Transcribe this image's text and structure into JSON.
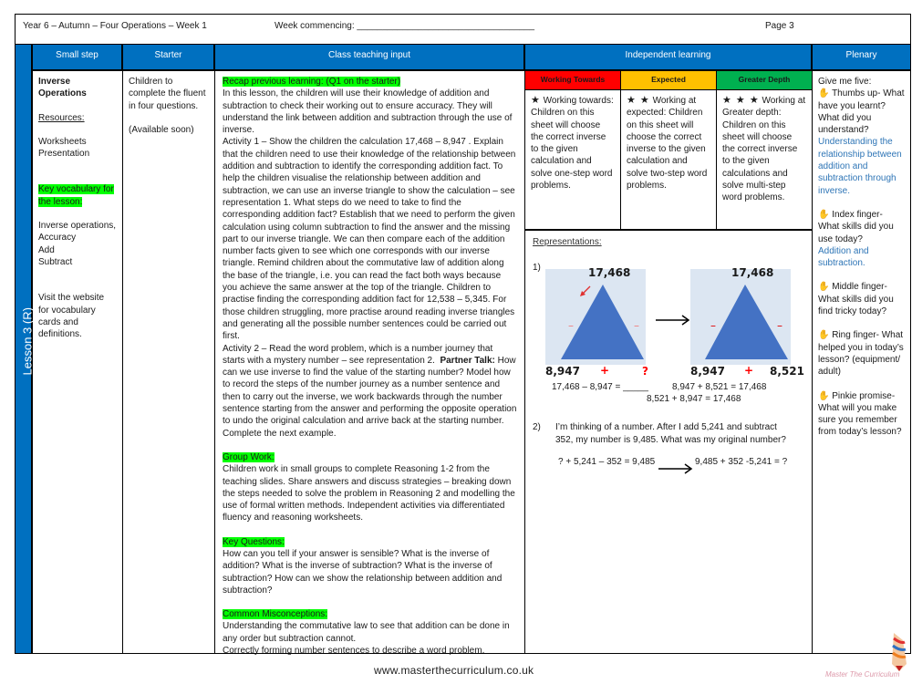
{
  "header": {
    "title": "Year 6 – Autumn – Four Operations – Week 1",
    "week_commencing": "Week commencing: ___________________________________",
    "page": "Page 3"
  },
  "side_label": "Lesson 3 (R)",
  "columns": {
    "small_step": "Small step",
    "starter": "Starter",
    "teaching": "Class teaching input",
    "independent": "Independent learning",
    "plenary": "Plenary"
  },
  "small_step": {
    "title": "Inverse Operations",
    "resources_label": "Resources:",
    "resources": [
      "Worksheets",
      "Presentation"
    ],
    "vocab_label": "Key vocabulary for the lesson:",
    "vocab": [
      "Inverse operations,",
      "Accuracy",
      "Add",
      "Subtract"
    ],
    "website_note": "Visit the website for vocabulary cards and definitions."
  },
  "starter": {
    "text": "Children to complete the fluent in four questions.",
    "note": "(Available soon)"
  },
  "teaching": {
    "recap_label": "Recap previous learning: (Q1 on the starter)",
    "intro": "In this lesson, the children will use their knowledge of addition and subtraction to check their working out to ensure accuracy. They will understand the link between addition and subtraction through the use of inverse.",
    "activity1": "Activity 1 – Show the children the calculation 17,468 – 8,947 . Explain that the children need to use their knowledge of the relationship between addition and subtraction to identify the corresponding addition fact. To help the children visualise the relationship between addition and subtraction, we can use an inverse triangle to show the calculation – see representation 1. What steps do we need to take to find the corresponding addition fact? Establish that we need to perform the given calculation using column subtraction to find the answer and the missing part to our inverse triangle. We can then compare each of the addition number facts given to see which one corresponds with our inverse triangle. Remind children about the commutative law of addition along the base of the triangle, i.e. you can read the fact both ways because you achieve the same answer at the top of the triangle. Children to practise finding the corresponding addition fact for 12,538 – 5,345.  For those children struggling, more practise around reading inverse triangles and generating all the possible number sentences could be carried out first.",
    "activity2_a": "Activity 2 – Read the word problem, which is a number journey that starts with a mystery number – see representation 2.",
    "partner_talk": "Partner Talk:",
    "activity2_b": "How can we use inverse to find the value of the starting number? Model how to record the steps of the number journey as a number sentence and then to carry out the inverse, we work backwards through the number sentence starting from the answer and performing the opposite operation to undo the original calculation and arrive back at the starting number. Complete the next example.",
    "group_label": "Group Work:",
    "group_text": "Children work in small groups to complete Reasoning 1-2 from the teaching slides. Share answers and discuss strategies – breaking down the steps needed to solve the problem in Reasoning 2 and modelling the use of formal written methods. Independent activities via differentiated fluency and reasoning worksheets.",
    "key_q_label": "Key Questions:",
    "key_q_text": "How can you tell if your answer is sensible? What is the inverse of addition? What is the inverse of subtraction? What is the inverse of subtraction? How can we show the relationship between addition and subtraction?",
    "misc_label": "Common Misconceptions:",
    "misc_1": "Understanding the commutative law to see that addition can be done in any order but subtraction cannot.",
    "misc_2": "Correctly forming number sentences to describe a word problem."
  },
  "independent": {
    "tiers": [
      {
        "label": "Working Towards",
        "color": "#ff0000",
        "stars": "★",
        "text": "Working towards: Children on this sheet will choose the correct inverse to the given calculation and solve one-step word problems."
      },
      {
        "label": "Expected",
        "color": "#ffc000",
        "stars": "★ ★",
        "text": "Working at expected: Children on this sheet will choose the correct inverse to the given calculation and solve two-step word problems."
      },
      {
        "label": "Greater Depth",
        "color": "#00b050",
        "stars": "★ ★ ★",
        "text": "Working at Greater depth: Children on this sheet will choose the correct inverse to the given calculations and solve multi-step word problems."
      }
    ],
    "reps_title": "Representations:",
    "rep1": {
      "num": "1)",
      "left": {
        "top": "17,468",
        "bl": "8,947",
        "plus": "+",
        "br": "?",
        "minus": "–"
      },
      "right": {
        "top": "17,468",
        "bl": "8,947",
        "plus": "+",
        "br": "8,521",
        "minus": "–"
      },
      "eq1": "17,468 – 8,947 = _____",
      "eq2": "8,947 + 8,521 = 17,468",
      "eq3": "8,521 + 8,947 = 17,468"
    },
    "rep2": {
      "num": "2)",
      "problem": "I’m thinking of a number. After I add 5,241 and subtract 352, my number is 9,485. What was my original number?",
      "eq_left": "? + 5,241 – 352 = 9,485",
      "eq_right": "9,485 + 352 -5,241 = ?"
    }
  },
  "plenary": {
    "intro": "Give me five:",
    "items": [
      {
        "icon": "hand-icon",
        "text": "Thumbs up- What have you learnt? What did you understand?",
        "answer": "Understanding the relationship between addition and subtraction through inverse."
      },
      {
        "icon": "hand-icon",
        "text": "Index finger- What skills did you use today?",
        "answer": "Addition and subtraction."
      },
      {
        "icon": "hand-icon",
        "text": "Middle finger- What skills did you find tricky today?",
        "answer": ""
      },
      {
        "icon": "hand-icon",
        "text": "Ring finger- What helped you in today’s lesson? (equipment/ adult)",
        "answer": ""
      },
      {
        "icon": "hand-icon",
        "text": "Pinkie promise- What will you make sure you remember from today’s lesson?",
        "answer": ""
      }
    ]
  },
  "footer": {
    "url": "www.masterthecurriculum.co.uk",
    "logo_text": "Master The Curriculum"
  },
  "colors": {
    "header_blue": "#0070c0",
    "highlight": "#00ff00",
    "answer_blue": "#2e75b6",
    "triangle": "#4472c4",
    "triangle_bg": "#dce6f2"
  }
}
